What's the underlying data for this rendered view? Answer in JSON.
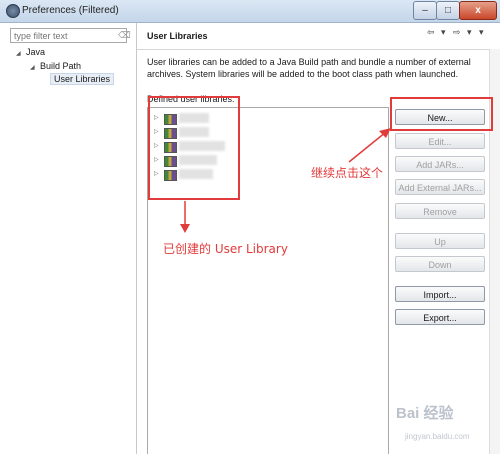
{
  "window": {
    "title": "Preferences (Filtered)",
    "min_glyph": "–",
    "max_glyph": "□",
    "close_glyph": "x"
  },
  "filter": {
    "placeholder": "type filter text"
  },
  "tree": {
    "java": "Java",
    "build_path": "Build Path",
    "user_libraries": "User Libraries"
  },
  "page": {
    "title": "User Libraries",
    "description": "User libraries can be added to a Java Build path and bundle a number of external archives. System libraries will be added to the boot class path when launched.",
    "defined_label": "Defined user libraries:"
  },
  "buttons": {
    "new": "New...",
    "edit": "Edit...",
    "add_jars": "Add JARs...",
    "add_external_jars": "Add External JARs...",
    "remove": "Remove",
    "up": "Up",
    "down": "Down",
    "import": "Import...",
    "export": "Export..."
  },
  "annotations": {
    "continue_click": "继续点击这个",
    "created_library": "已创建的 User Library"
  },
  "watermark": {
    "main": "Bai 经验",
    "sub": "jingyan.baidu.com"
  },
  "colors": {
    "annotation": "#e23b3b"
  }
}
